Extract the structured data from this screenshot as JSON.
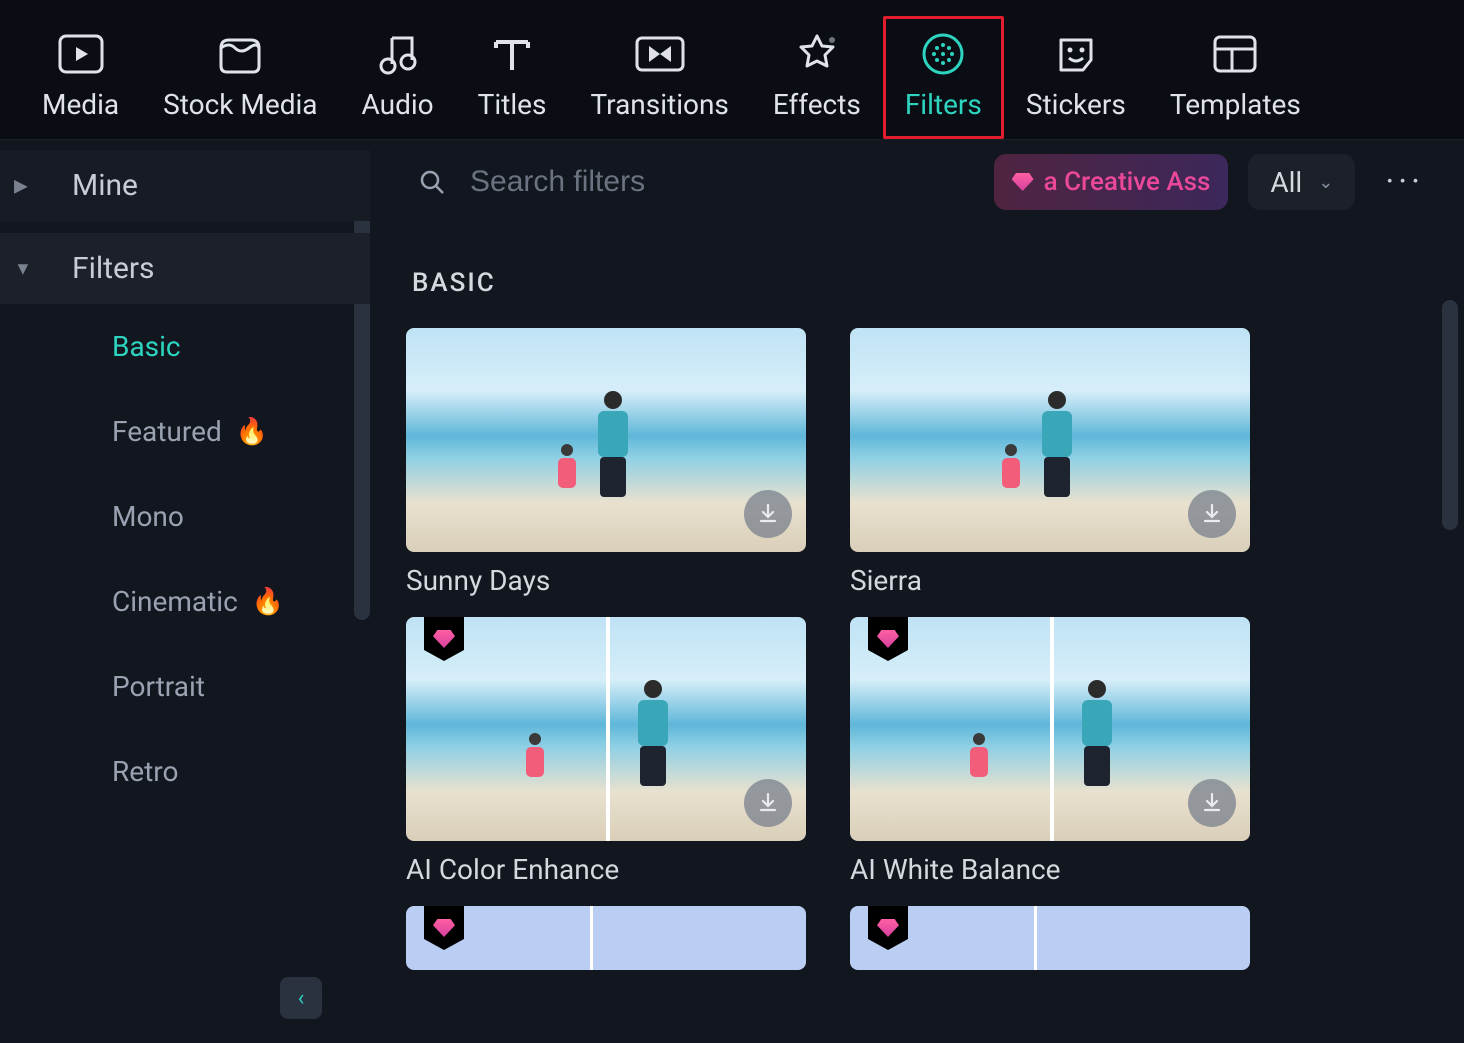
{
  "topnav": {
    "items": [
      {
        "label": "Media",
        "icon": "media-icon"
      },
      {
        "label": "Stock Media",
        "icon": "stock-media-icon"
      },
      {
        "label": "Audio",
        "icon": "audio-icon"
      },
      {
        "label": "Titles",
        "icon": "titles-icon"
      },
      {
        "label": "Transitions",
        "icon": "transitions-icon"
      },
      {
        "label": "Effects",
        "icon": "effects-icon"
      },
      {
        "label": "Filters",
        "icon": "filters-icon"
      },
      {
        "label": "Stickers",
        "icon": "stickers-icon"
      },
      {
        "label": "Templates",
        "icon": "templates-icon"
      }
    ],
    "active_index": 6
  },
  "sidebar": {
    "groups": [
      {
        "label": "Mine",
        "expanded": false
      },
      {
        "label": "Filters",
        "expanded": true
      }
    ],
    "filter_categories": [
      {
        "label": "Basic",
        "active": true,
        "hot": false
      },
      {
        "label": "Featured",
        "active": false,
        "hot": true
      },
      {
        "label": "Mono",
        "active": false,
        "hot": false
      },
      {
        "label": "Cinematic",
        "active": false,
        "hot": true
      },
      {
        "label": "Portrait",
        "active": false,
        "hot": false
      },
      {
        "label": "Retro",
        "active": false,
        "hot": false
      }
    ]
  },
  "toolbar": {
    "search_placeholder": "Search filters",
    "creative_badge_text": "a Creative Ass",
    "dropdown_label": "All",
    "more_label": "···"
  },
  "section": {
    "title": "BASIC"
  },
  "filters_grid": [
    {
      "label": "Sunny Days",
      "premium": false,
      "split": false
    },
    {
      "label": "Sierra",
      "premium": false,
      "split": false
    },
    {
      "label": "AI Color Enhance",
      "premium": true,
      "split": true
    },
    {
      "label": "AI White Balance",
      "premium": true,
      "split": true
    }
  ],
  "colors": {
    "accent": "#2dd4bf",
    "highlight_border": "#e11d2e",
    "premium": "#ec4899"
  }
}
